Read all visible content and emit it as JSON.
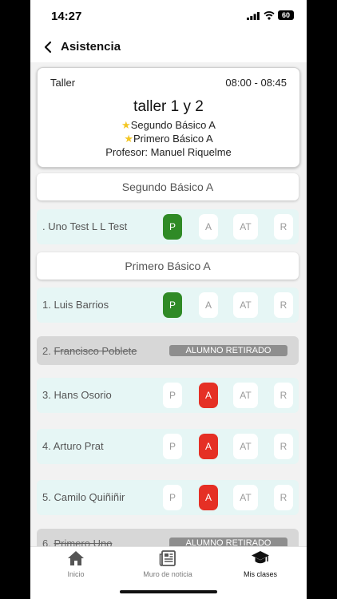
{
  "status_bar": {
    "time": "14:27",
    "battery": "60"
  },
  "header": {
    "title": "Asistencia"
  },
  "class_card": {
    "type": "Taller",
    "time_range": "08:00 - 08:45",
    "name": "taller 1 y 2",
    "courses": [
      "Segundo Básico A",
      "Primero Básico A"
    ],
    "teacher": "Profesor: Manuel Riquelme"
  },
  "attendance_options": [
    "P",
    "A",
    "AT",
    "R"
  ],
  "sections": [
    {
      "title": "Segundo Básico A",
      "students": [
        {
          "name": ". Uno Test L L Test",
          "status": "P"
        }
      ]
    },
    {
      "title": "Primero Básico A",
      "students": [
        {
          "number": "1.",
          "name": "Luis Barrios",
          "status": "P"
        },
        {
          "number": "2.",
          "name": "Francisco Poblete",
          "retired_label": "ALUMNO RETIRADO"
        },
        {
          "number": "3.",
          "name": "Hans Osorio",
          "status": "A"
        },
        {
          "number": "4.",
          "name": "Arturo Prat",
          "status": "A"
        },
        {
          "number": "5.",
          "name": "Camilo Quiñiñir",
          "status": "A"
        },
        {
          "number": "6.",
          "name": "Primero Uno",
          "retired_label": "ALUMNO RETIRADO"
        }
      ]
    }
  ],
  "bottom_nav": {
    "items": [
      {
        "label": "Inicio",
        "icon": "home-icon"
      },
      {
        "label": "Muro de noticia",
        "icon": "newspaper-icon"
      },
      {
        "label": "Mis clases",
        "icon": "graduation-cap-icon",
        "active": true
      }
    ]
  },
  "colors": {
    "present": "#2f8a26",
    "absent": "#e53025",
    "row_background": "#e6f6f5",
    "retired_background": "#d7d7d7",
    "retired_badge": "#8e8e8e"
  }
}
